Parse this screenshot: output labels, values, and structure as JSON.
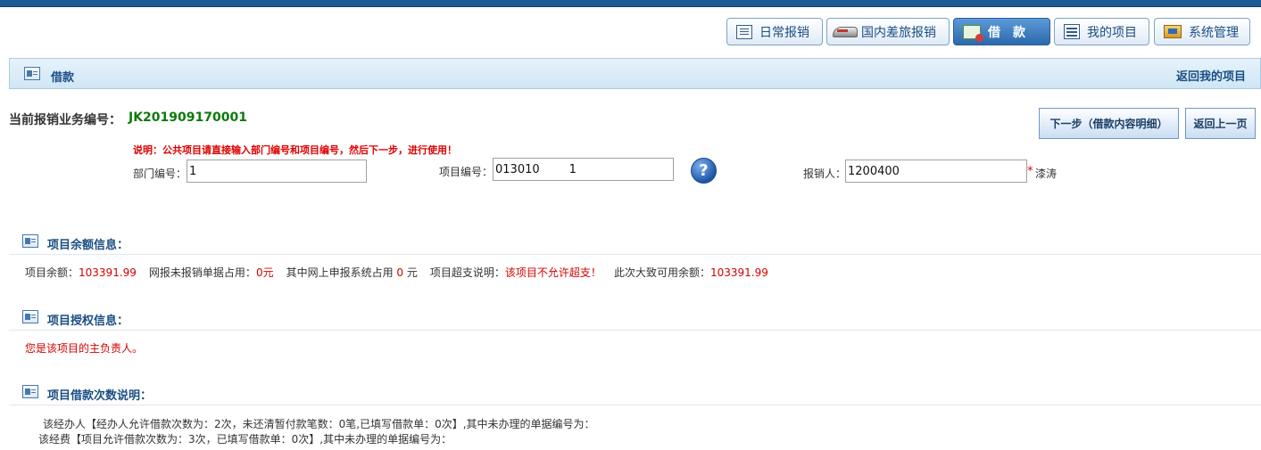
{
  "nav": {
    "daily": "日常报销",
    "travel": "国内差旅报销",
    "loan": "借　款",
    "projects": "我的项目",
    "admin": "系统管理"
  },
  "header": {
    "title": "借款",
    "back_link": "返回我的项目"
  },
  "business": {
    "label": "当前报销业务编号：",
    "number": "JK201909170001"
  },
  "buttons": {
    "next": "下一步（借款内容明细）",
    "back": "返回上一页"
  },
  "note": "说明：公共项目请直接输入部门编号和项目编号，然后下一步，进行使用！",
  "form": {
    "dept_label": "部门编号：",
    "dept_value": "1",
    "project_label": "项目编号：",
    "project_value": "013010        1",
    "person_label": "报销人：",
    "person_value": "1200400",
    "required_mark": "*",
    "person_name": "漆涛"
  },
  "balance": {
    "title": "项目余额信息：",
    "balance_label": "项目余额：",
    "balance_value": "103391.99",
    "unreimbursed_label": "网报未报销单据占用：",
    "unreimbursed_value": "0元",
    "online_label": "其中网上申报系统占用",
    "online_value": "0",
    "online_unit": "元",
    "overdraft_label": "项目超支说明：",
    "overdraft_value": "该项目不允许超支！",
    "available_label": "此次大致可用余额：",
    "available_value": "103391.99"
  },
  "authorization": {
    "title": "项目授权信息：",
    "text": "您是该项目的主负责人。"
  },
  "loan_count": {
    "title": "项目借款次数说明：",
    "line1": "该经办人【经办人允许借款次数为：2次，未还清暂付款笔数：0笔,已填写借款单：0次】,其中未办理的单据编号为：",
    "line2": "该经费【项目允许借款次数为：3次，已填写借款单：0次】,其中未办理的单据编号为："
  },
  "colors": {
    "accent": "#1b4e84",
    "active_tab": "#2a69ac",
    "warning": "#d40000",
    "success": "#0b7a0b"
  },
  "icons": [
    "notebook-icon",
    "train-icon",
    "loan-icon",
    "list-icon",
    "computer-icon",
    "card-icon",
    "help-icon"
  ]
}
